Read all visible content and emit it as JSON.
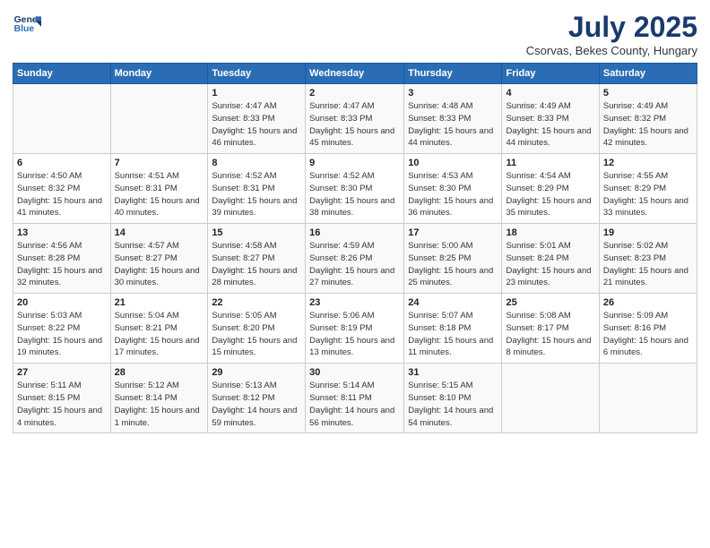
{
  "header": {
    "logo_line1": "General",
    "logo_line2": "Blue",
    "title": "July 2025",
    "subtitle": "Csorvas, Bekes County, Hungary"
  },
  "days": [
    "Sunday",
    "Monday",
    "Tuesday",
    "Wednesday",
    "Thursday",
    "Friday",
    "Saturday"
  ],
  "weeks": [
    [
      {
        "date": "",
        "info": ""
      },
      {
        "date": "",
        "info": ""
      },
      {
        "date": "1",
        "info": "Sunrise: 4:47 AM\nSunset: 8:33 PM\nDaylight: 15 hours and 46 minutes."
      },
      {
        "date": "2",
        "info": "Sunrise: 4:47 AM\nSunset: 8:33 PM\nDaylight: 15 hours and 45 minutes."
      },
      {
        "date": "3",
        "info": "Sunrise: 4:48 AM\nSunset: 8:33 PM\nDaylight: 15 hours and 44 minutes."
      },
      {
        "date": "4",
        "info": "Sunrise: 4:49 AM\nSunset: 8:33 PM\nDaylight: 15 hours and 44 minutes."
      },
      {
        "date": "5",
        "info": "Sunrise: 4:49 AM\nSunset: 8:32 PM\nDaylight: 15 hours and 42 minutes."
      }
    ],
    [
      {
        "date": "6",
        "info": "Sunrise: 4:50 AM\nSunset: 8:32 PM\nDaylight: 15 hours and 41 minutes."
      },
      {
        "date": "7",
        "info": "Sunrise: 4:51 AM\nSunset: 8:31 PM\nDaylight: 15 hours and 40 minutes."
      },
      {
        "date": "8",
        "info": "Sunrise: 4:52 AM\nSunset: 8:31 PM\nDaylight: 15 hours and 39 minutes."
      },
      {
        "date": "9",
        "info": "Sunrise: 4:52 AM\nSunset: 8:30 PM\nDaylight: 15 hours and 38 minutes."
      },
      {
        "date": "10",
        "info": "Sunrise: 4:53 AM\nSunset: 8:30 PM\nDaylight: 15 hours and 36 minutes."
      },
      {
        "date": "11",
        "info": "Sunrise: 4:54 AM\nSunset: 8:29 PM\nDaylight: 15 hours and 35 minutes."
      },
      {
        "date": "12",
        "info": "Sunrise: 4:55 AM\nSunset: 8:29 PM\nDaylight: 15 hours and 33 minutes."
      }
    ],
    [
      {
        "date": "13",
        "info": "Sunrise: 4:56 AM\nSunset: 8:28 PM\nDaylight: 15 hours and 32 minutes."
      },
      {
        "date": "14",
        "info": "Sunrise: 4:57 AM\nSunset: 8:27 PM\nDaylight: 15 hours and 30 minutes."
      },
      {
        "date": "15",
        "info": "Sunrise: 4:58 AM\nSunset: 8:27 PM\nDaylight: 15 hours and 28 minutes."
      },
      {
        "date": "16",
        "info": "Sunrise: 4:59 AM\nSunset: 8:26 PM\nDaylight: 15 hours and 27 minutes."
      },
      {
        "date": "17",
        "info": "Sunrise: 5:00 AM\nSunset: 8:25 PM\nDaylight: 15 hours and 25 minutes."
      },
      {
        "date": "18",
        "info": "Sunrise: 5:01 AM\nSunset: 8:24 PM\nDaylight: 15 hours and 23 minutes."
      },
      {
        "date": "19",
        "info": "Sunrise: 5:02 AM\nSunset: 8:23 PM\nDaylight: 15 hours and 21 minutes."
      }
    ],
    [
      {
        "date": "20",
        "info": "Sunrise: 5:03 AM\nSunset: 8:22 PM\nDaylight: 15 hours and 19 minutes."
      },
      {
        "date": "21",
        "info": "Sunrise: 5:04 AM\nSunset: 8:21 PM\nDaylight: 15 hours and 17 minutes."
      },
      {
        "date": "22",
        "info": "Sunrise: 5:05 AM\nSunset: 8:20 PM\nDaylight: 15 hours and 15 minutes."
      },
      {
        "date": "23",
        "info": "Sunrise: 5:06 AM\nSunset: 8:19 PM\nDaylight: 15 hours and 13 minutes."
      },
      {
        "date": "24",
        "info": "Sunrise: 5:07 AM\nSunset: 8:18 PM\nDaylight: 15 hours and 11 minutes."
      },
      {
        "date": "25",
        "info": "Sunrise: 5:08 AM\nSunset: 8:17 PM\nDaylight: 15 hours and 8 minutes."
      },
      {
        "date": "26",
        "info": "Sunrise: 5:09 AM\nSunset: 8:16 PM\nDaylight: 15 hours and 6 minutes."
      }
    ],
    [
      {
        "date": "27",
        "info": "Sunrise: 5:11 AM\nSunset: 8:15 PM\nDaylight: 15 hours and 4 minutes."
      },
      {
        "date": "28",
        "info": "Sunrise: 5:12 AM\nSunset: 8:14 PM\nDaylight: 15 hours and 1 minute."
      },
      {
        "date": "29",
        "info": "Sunrise: 5:13 AM\nSunset: 8:12 PM\nDaylight: 14 hours and 59 minutes."
      },
      {
        "date": "30",
        "info": "Sunrise: 5:14 AM\nSunset: 8:11 PM\nDaylight: 14 hours and 56 minutes."
      },
      {
        "date": "31",
        "info": "Sunrise: 5:15 AM\nSunset: 8:10 PM\nDaylight: 14 hours and 54 minutes."
      },
      {
        "date": "",
        "info": ""
      },
      {
        "date": "",
        "info": ""
      }
    ]
  ]
}
